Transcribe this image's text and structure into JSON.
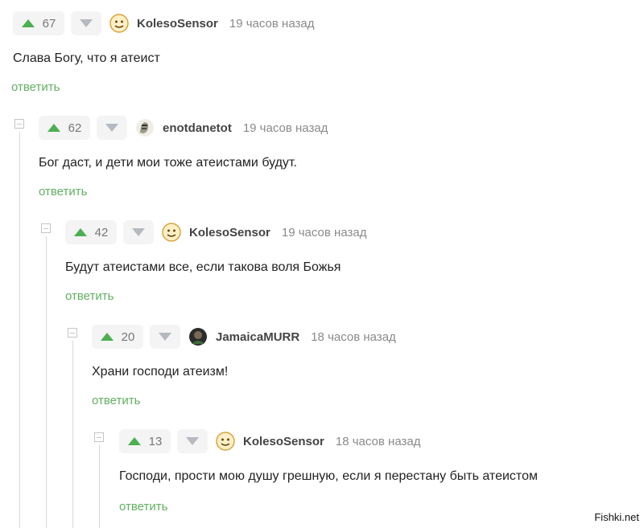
{
  "comments": [
    {
      "rating": "67",
      "username": "KolesoSensor",
      "time": "19 часов назад",
      "text": "Слава Богу, что я атеист",
      "reply": "ответить"
    },
    {
      "rating": "62",
      "username": "enotdanetot",
      "time": "19 часов назад",
      "text": "Бог даст, и дети мои тоже атеистами будут.",
      "reply": "ответить"
    },
    {
      "rating": "42",
      "username": "KolesoSensor",
      "time": "19 часов назад",
      "text": "Будут атеистами все, если такова воля Божья",
      "reply": "ответить"
    },
    {
      "rating": "20",
      "username": "JamaicaMURR",
      "time": "18 часов назад",
      "text": "Храни господи атеизм!",
      "reply": "ответить"
    },
    {
      "rating": "13",
      "username": "KolesoSensor",
      "time": "18 часов назад",
      "text": "Господи, прости мою душу грешную, если я перестану быть атеистом",
      "reply": "ответить"
    }
  ],
  "watermark": "Fishki.net",
  "colors": {
    "upvote": "#4caf50",
    "reply_link": "#62b062",
    "thread_line": "#d8d8d8"
  }
}
